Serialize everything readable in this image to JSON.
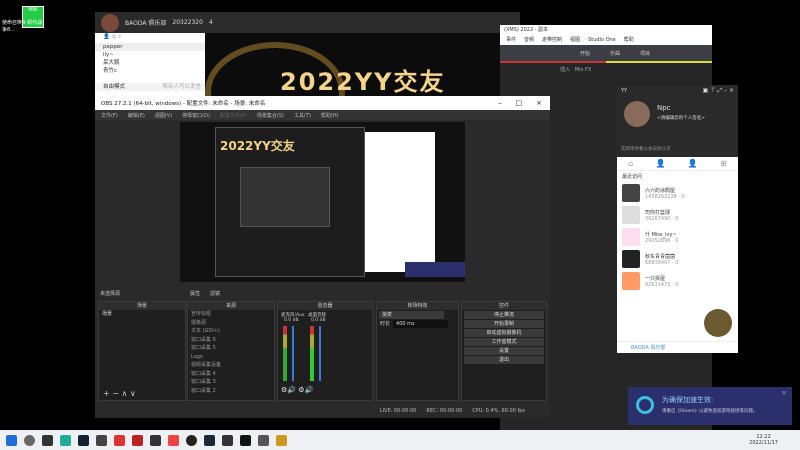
{
  "desktop": {
    "icon_label": "使命召唤8-现代战争8...",
    "icon_text": "MW"
  },
  "yy": {
    "club": "BAODA 俱乐部",
    "room_id": "20322320",
    "online": "4",
    "users": [
      "pepper",
      "lly~",
      "呆大鹅",
      "青竹c"
    ],
    "mode": "自由模式",
    "speak": "所有人可以发言",
    "banner": "2022YY交友"
  },
  "obs": {
    "title": "OBS 27.2.1 (64-bit, windows) - 配置文件: 未命名 - 场景: 未命名",
    "menu": [
      "文件(F)",
      "编辑(E)",
      "视图(V)",
      "停靠窗口(D)",
      "配置文件(P)",
      "场景集合(S)",
      "工具(T)",
      "帮助(H)"
    ],
    "no_source": "未选择源",
    "props": "属性",
    "filters": "滤镜",
    "docks": {
      "scenes": "场景",
      "sources": "来源",
      "mixer": "混音器",
      "transitions": "转场特效",
      "controls": "控件"
    },
    "scene_items": [
      "场景"
    ],
    "source_items": [
      "宣传标题",
      "摄像源",
      "文本 (GDI+)",
      "窗口采集 6",
      "窗口采集 5",
      "Logo",
      "视频采集设备",
      "窗口采集 4",
      "窗口采集 3",
      "窗口采集 2"
    ],
    "mixer": [
      {
        "name": "麦克风/Aux",
        "db": "0.0 dB"
      },
      {
        "name": "桌面音频",
        "db": "0.0 dB"
      }
    ],
    "transition": "渐变",
    "duration_label": "时长",
    "duration": "400 ms",
    "controls": [
      "停止推流",
      "开始录制",
      "启动虚拟摄像机",
      "工作室模式",
      "设置",
      "退出"
    ],
    "status": {
      "live": "LIVE: 00:00:00",
      "rec": "REC: 00:00:00",
      "cpu": "CPU: 0.4%, 60.00 fps"
    }
  },
  "studio_one": {
    "title": "(XMS) 2022 - 副本",
    "menu": [
      "事件",
      "音频",
      "走带控制",
      "视图",
      "Studio One",
      "帮助"
    ],
    "toolbar": [
      "开始",
      "乐曲",
      "项目"
    ],
    "insert": "插入",
    "mixfx": "Mix FX"
  },
  "yy_panel": {
    "app": "YY",
    "name": "Npc",
    "sign": "<请编辑您的个人签名>",
    "notice": "实际带你看公会去你认识",
    "recent": "最近访问",
    "items": [
      {
        "name": "六六的涂鸦屋",
        "id": "1458262228",
        "n": "0"
      },
      {
        "name": "司你打篮球",
        "id": "39167490",
        "n": "0"
      },
      {
        "name": "什 Miss_ivy~",
        "id": "29052896",
        "n": "0"
      },
      {
        "name": "秋东青青茵茵",
        "id": "68838407",
        "n": "0"
      },
      {
        "name": "一只拆屋",
        "id": "82631473",
        "n": "0"
      }
    ],
    "footer": "BAODA 俱乐部"
  },
  "notification": {
    "title": "为确保加速生效:",
    "body": "请重启《Steam》以避免后续游戏链接等问题。"
  },
  "taskbar": {
    "time": "12:22",
    "date": "2022/11/17"
  }
}
